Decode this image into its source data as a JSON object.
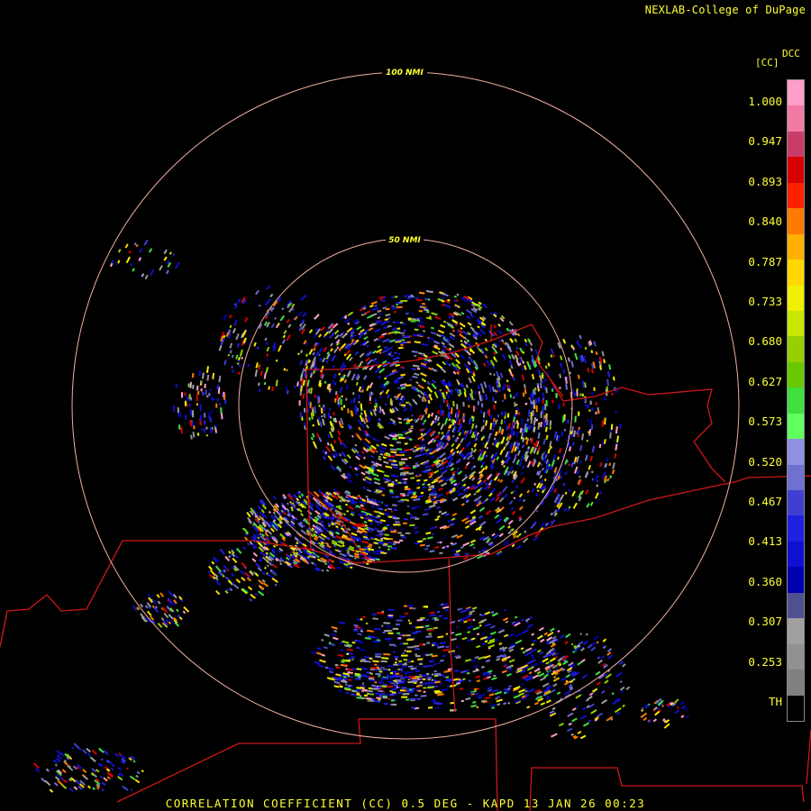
{
  "header": {
    "credit": "NEXLAB-College of DuPage"
  },
  "legend": {
    "product": "DCC",
    "unit": "[CC]",
    "ticks": [
      "1.000",
      "0.947",
      "0.893",
      "0.840",
      "0.787",
      "0.733",
      "0.680",
      "0.627",
      "0.573",
      "0.520",
      "0.467",
      "0.413",
      "0.360",
      "0.307",
      "0.253",
      "TH"
    ],
    "colors": [
      "#ff9ec8",
      "#f07aa4",
      "#c83c68",
      "#d80000",
      "#ff2000",
      "#ff7a00",
      "#ffb000",
      "#ffd800",
      "#f0f000",
      "#c8e600",
      "#96d000",
      "#6ac800",
      "#40e040",
      "#60ff60",
      "#9090e0",
      "#7070d0",
      "#4040d0",
      "#2020e0",
      "#1010d0",
      "#0000b0",
      "#505090",
      "#a0a0a0",
      "#909090",
      "#808080",
      "#000000"
    ]
  },
  "range_rings": [
    {
      "label": "100 NMI"
    },
    {
      "label": "50 NMI"
    }
  ],
  "footer": {
    "caption": "CORRELATION COEFFICIENT (CC) 0.5 DEG - KAPD 13 JAN 26 00:23"
  }
}
